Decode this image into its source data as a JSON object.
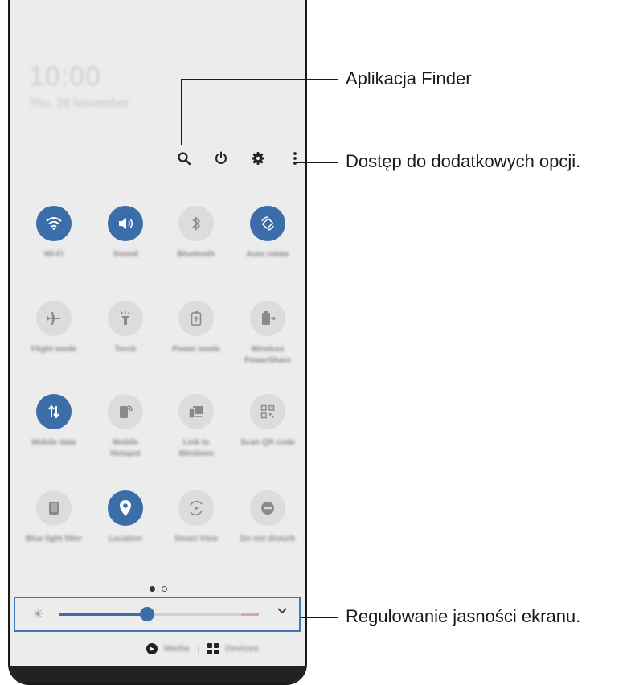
{
  "status": {
    "time": "10:00",
    "date": "Thu, 28 November"
  },
  "quick_panel": {
    "top_icons": [
      {
        "name": "search-icon"
      },
      {
        "name": "power-icon"
      },
      {
        "name": "settings-icon"
      },
      {
        "name": "more-options-icon"
      }
    ],
    "tiles": [
      {
        "label": "Wi-Fi",
        "icon": "wifi-icon",
        "active": true
      },
      {
        "label": "Sound",
        "icon": "sound-icon",
        "active": true
      },
      {
        "label": "Bluetooth",
        "icon": "bluetooth-icon",
        "active": false
      },
      {
        "label": "Auto rotate",
        "icon": "rotate-icon",
        "active": true
      },
      {
        "label": "Flight mode",
        "icon": "airplane-icon",
        "active": false
      },
      {
        "label": "Torch",
        "icon": "torch-icon",
        "active": false
      },
      {
        "label": "Power mode",
        "icon": "battery-icon",
        "active": false
      },
      {
        "label": "Wireless PowerShare",
        "icon": "powershare-icon",
        "active": false
      },
      {
        "label": "Mobile data",
        "icon": "data-icon",
        "active": true
      },
      {
        "label": "Mobile Hotspot",
        "icon": "hotspot-icon",
        "active": false
      },
      {
        "label": "Link to Windows",
        "icon": "link-windows-icon",
        "active": false
      },
      {
        "label": "Scan QR code",
        "icon": "qr-icon",
        "active": false
      },
      {
        "label": "Blue light filter",
        "icon": "bluelight-icon",
        "active": false
      },
      {
        "label": "Location",
        "icon": "location-icon",
        "active": true
      },
      {
        "label": "Smart View",
        "icon": "smartview-icon",
        "active": false
      },
      {
        "label": "Do not disturb",
        "icon": "dnd-icon",
        "active": false
      }
    ],
    "page_count": 2,
    "current_page": 1,
    "brightness": {
      "level": 0.44,
      "icon": "sun-icon"
    },
    "bottom": {
      "media_label": "Media",
      "devices_label": "Devices"
    }
  },
  "callouts": {
    "finder": "Aplikacja Finder",
    "more_options": "Dostęp do dodatkowych opcji.",
    "brightness": "Regulowanie jasności ekranu."
  },
  "colors": {
    "active_tile": "#3b6ea8",
    "inactive_tile": "#dcdcdc",
    "highlight_box": "#3f78b8"
  }
}
